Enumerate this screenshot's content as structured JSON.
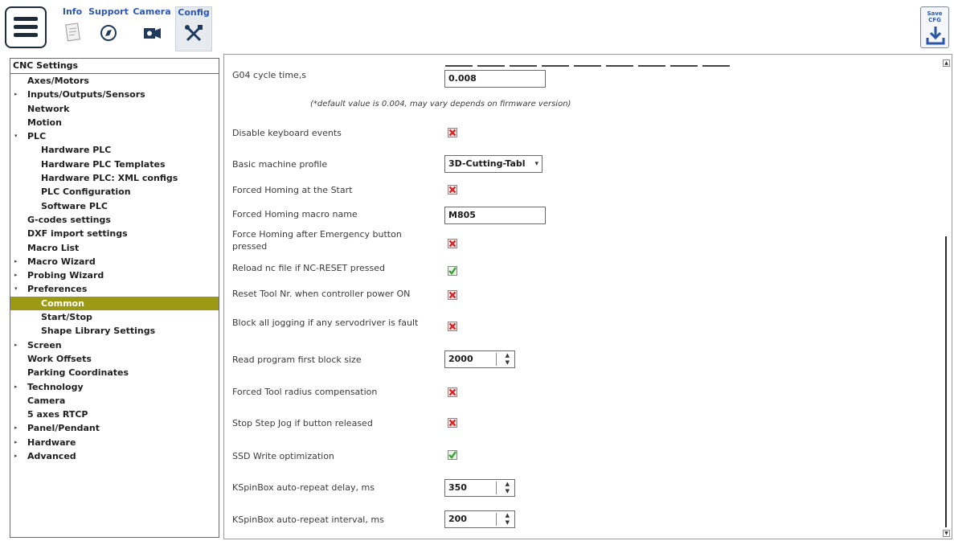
{
  "toolbar": {
    "tabs": [
      {
        "label": "Info",
        "icon": "document-icon"
      },
      {
        "label": "Support",
        "icon": "compass-icon"
      },
      {
        "label": "Camera",
        "icon": "video-camera-icon"
      },
      {
        "label": "Config",
        "icon": "tools-icon"
      }
    ],
    "active_tab": "Config",
    "save_button_text": "Save CFG",
    "save_icon": "download-icon"
  },
  "sidebar": {
    "header": "CNC Settings",
    "selected_item": "Common",
    "selected_color": "#9c9a14",
    "items": [
      {
        "label": "Axes/Motors",
        "level": 1,
        "expander": ""
      },
      {
        "label": "Inputs/Outputs/Sensors",
        "level": 1,
        "expander": "▸"
      },
      {
        "label": "Network",
        "level": 1,
        "expander": ""
      },
      {
        "label": "Motion",
        "level": 1,
        "expander": ""
      },
      {
        "label": "PLC",
        "level": 1,
        "expander": "▾"
      },
      {
        "label": "Hardware PLC",
        "level": 2,
        "expander": ""
      },
      {
        "label": "Hardware PLC Templates",
        "level": 2,
        "expander": ""
      },
      {
        "label": "Hardware PLC: XML configs",
        "level": 2,
        "expander": ""
      },
      {
        "label": "PLC Configuration",
        "level": 2,
        "expander": ""
      },
      {
        "label": "Software PLC",
        "level": 2,
        "expander": ""
      },
      {
        "label": "G-codes settings",
        "level": 1,
        "expander": ""
      },
      {
        "label": "DXF import settings",
        "level": 1,
        "expander": ""
      },
      {
        "label": "Macro List",
        "level": 1,
        "expander": ""
      },
      {
        "label": "Macro Wizard",
        "level": 1,
        "expander": "▸"
      },
      {
        "label": "Probing Wizard",
        "level": 1,
        "expander": "▸"
      },
      {
        "label": "Preferences",
        "level": 1,
        "expander": "▾"
      },
      {
        "label": "Common",
        "level": 2,
        "expander": ""
      },
      {
        "label": "Start/Stop",
        "level": 2,
        "expander": ""
      },
      {
        "label": "Shape Library Settings",
        "level": 2,
        "expander": ""
      },
      {
        "label": "Screen",
        "level": 1,
        "expander": "▸"
      },
      {
        "label": "Work Offsets",
        "level": 1,
        "expander": ""
      },
      {
        "label": "Parking Coordinates",
        "level": 1,
        "expander": ""
      },
      {
        "label": "Technology",
        "level": 1,
        "expander": "▸"
      },
      {
        "label": "Camera",
        "level": 1,
        "expander": ""
      },
      {
        "label": "5 axes RTCP",
        "level": 1,
        "expander": ""
      },
      {
        "label": "Panel/Pendant",
        "level": 1,
        "expander": "▸"
      },
      {
        "label": "Hardware",
        "level": 1,
        "expander": "▸"
      },
      {
        "label": "Advanced",
        "level": 1,
        "expander": "▸"
      }
    ]
  },
  "settings": {
    "note": "(*default value is 0.004, may vary depends on firmware version)",
    "rows": [
      {
        "label": "G04 cycle time,s",
        "type": "text",
        "value": "0.008"
      },
      {
        "label": "Disable keyboard events",
        "type": "checkbox",
        "checked": false
      },
      {
        "label": "Basic machine profile",
        "type": "combo",
        "value": "3D-Cutting-Tabl"
      },
      {
        "label": "Forced Homing at the Start",
        "type": "checkbox",
        "checked": false
      },
      {
        "label": "Forced Homing macro name",
        "type": "text",
        "value": "M805"
      },
      {
        "label": "Force Homing after Emergency button pressed",
        "type": "checkbox",
        "checked": false
      },
      {
        "label": "Reload nc file if NC-RESET pressed",
        "type": "checkbox",
        "checked": true
      },
      {
        "label": "Reset Tool Nr. when controller power ON",
        "type": "checkbox",
        "checked": false
      },
      {
        "label": "Block all jogging if any servodriver is fault",
        "type": "checkbox",
        "checked": false
      },
      {
        "label": "Read program first block size",
        "type": "spin",
        "value": "2000"
      },
      {
        "label": "Forced Tool radius compensation",
        "type": "checkbox",
        "checked": false
      },
      {
        "label": "Stop Step Jog if button released",
        "type": "checkbox",
        "checked": false
      },
      {
        "label": "SSD Write optimization",
        "type": "checkbox",
        "checked": true
      },
      {
        "label": "KSpinBox auto-repeat delay, ms",
        "type": "spin",
        "value": "350"
      },
      {
        "label": "KSpinBox auto-repeat interval, ms",
        "type": "spin",
        "value": "200"
      }
    ]
  },
  "colors": {
    "checked": "#3aa23a",
    "unchecked": "#d42a2a",
    "tab_label": "#2c56b0"
  }
}
